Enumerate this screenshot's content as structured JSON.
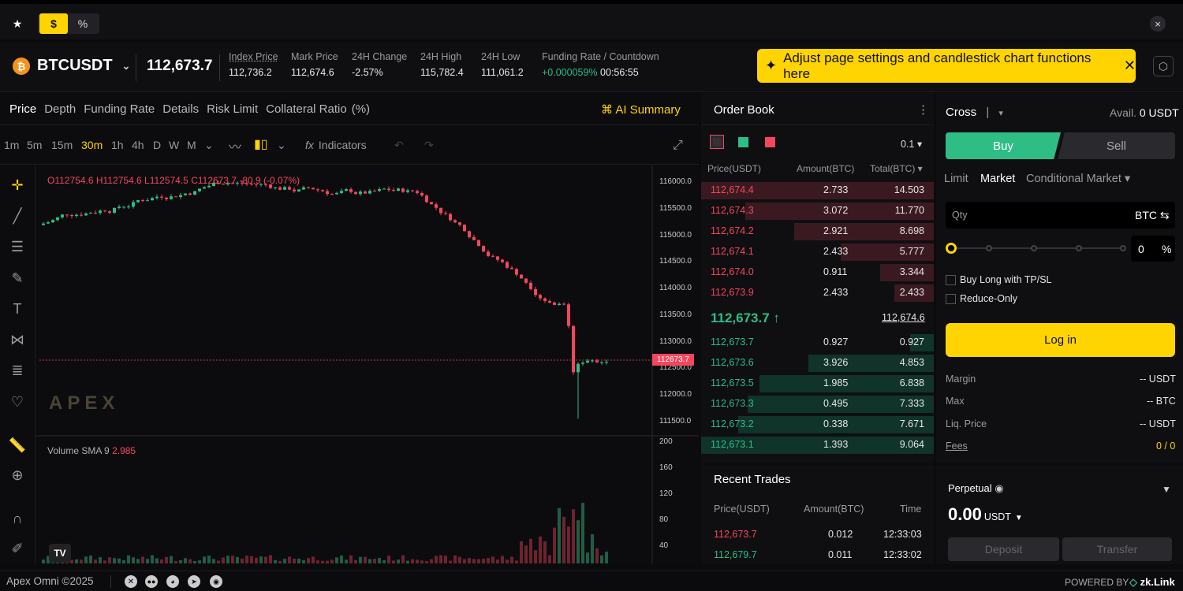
{
  "colors": {
    "accent": "#ffd400",
    "up": "#2ebd85",
    "down": "#f6465d",
    "bg": "#0b0b0d"
  },
  "topbar": {
    "star_icon": "star-icon",
    "dollar": "$",
    "percent": "%",
    "close": "×"
  },
  "ticker": {
    "symbol": "BTCUSDT",
    "price": "112,673.7",
    "stats": [
      {
        "label": "Index Price",
        "value": "112,736.2"
      },
      {
        "label": "Mark Price",
        "value": "112,674.6"
      },
      {
        "label": "24H Change",
        "value": "-2.57%"
      },
      {
        "label": "24H High",
        "value": "115,782.4"
      },
      {
        "label": "24H Low",
        "value": "111,061.2"
      },
      {
        "label": "Funding Rate / Countdown",
        "value": "+0.000059%",
        "countdown": "00:56:55"
      }
    ],
    "banner": "Adjust page settings and candlestick chart functions here"
  },
  "chart": {
    "tabs": [
      "Price",
      "Depth",
      "Funding Rate",
      "Details",
      "Risk Limit",
      "Collateral Ratio",
      "(%)"
    ],
    "ai_summary": "AI Summary",
    "timeframes": [
      "1m",
      "5m",
      "15m",
      "30m",
      "1h",
      "4h",
      "D",
      "W",
      "M"
    ],
    "indicators": "Indicators",
    "ohlc": {
      "o": "O112754.6",
      "h": "H112754.6",
      "l": "L112574.5",
      "c": "C112673.7",
      "chg": "-80.9 (-0.07%)"
    },
    "price_axis": [
      "116000.0",
      "115500.0",
      "115000.0",
      "114500.0",
      "114000.0",
      "113500.0",
      "113000.0",
      "112500.0",
      "112000.0",
      "111500.0"
    ],
    "last_price": "112673.7",
    "volume_label": "Volume SMA 9",
    "volume_value": "2.985",
    "volume_axis": [
      "200",
      "160",
      "120",
      "80",
      "40"
    ],
    "logo": "APEX"
  },
  "orderbook": {
    "title": "Order Book",
    "step": "0.1",
    "headers": [
      "Price(USDT)",
      "Amount(BTC)",
      "Total(BTC)"
    ],
    "asks": [
      [
        "112,674.4",
        "2.733",
        "14.503"
      ],
      [
        "112,674.3",
        "3.072",
        "11.770"
      ],
      [
        "112,674.2",
        "2.921",
        "8.698"
      ],
      [
        "112,674.1",
        "2.433",
        "5.777"
      ],
      [
        "112,674.0",
        "0.911",
        "3.344"
      ],
      [
        "112,673.9",
        "2.433",
        "2.433"
      ]
    ],
    "asks_depth": [
      1.0,
      0.81,
      0.6,
      0.4,
      0.23,
      0.17
    ],
    "mid": "112,673.7",
    "mid_mark": "112,674.6",
    "bids": [
      [
        "112,673.7",
        "0.927",
        "0.927"
      ],
      [
        "112,673.6",
        "3.926",
        "4.853"
      ],
      [
        "112,673.5",
        "1.985",
        "6.838"
      ],
      [
        "112,673.3",
        "0.495",
        "7.333"
      ],
      [
        "112,673.2",
        "0.338",
        "7.671"
      ],
      [
        "112,673.1",
        "1.393",
        "9.064"
      ]
    ],
    "bids_depth": [
      0.1,
      0.54,
      0.75,
      0.8,
      0.84,
      1.0
    ]
  },
  "recent_trades": {
    "title": "Recent Trades",
    "headers": [
      "Price(USDT)",
      "Amount(BTC)",
      "Time"
    ],
    "rows": [
      [
        "112,673.7",
        "0.012",
        "12:33:03",
        "down"
      ],
      [
        "112,679.7",
        "0.011",
        "12:33:02",
        "up"
      ]
    ]
  },
  "trade": {
    "margin_mode": "Cross",
    "avail_label": "Avail.",
    "avail_value": "0 USDT",
    "buy": "Buy",
    "sell": "Sell",
    "order_types": [
      "Limit",
      "Market",
      "Conditional Market"
    ],
    "qty_placeholder": "Qty",
    "qty_unit": "BTC",
    "pct_value": "0",
    "pct_unit": "%",
    "tpsl": "Buy Long with TP/SL",
    "reduce": "Reduce-Only",
    "login": "Log in",
    "info": [
      [
        "Margin",
        "-- USDT"
      ],
      [
        "Max",
        "-- BTC"
      ],
      [
        "Liq. Price",
        "-- USDT"
      ],
      [
        "Fees",
        "0 / 0"
      ]
    ]
  },
  "perpetual": {
    "title": "Perpetual",
    "balance": "0.00",
    "unit": "USDT",
    "deposit": "Deposit",
    "transfer": "Transfer"
  },
  "footer": {
    "copyright": "Apex Omni ©2025",
    "powered": "POWERED BY",
    "brand": "zk.Link"
  }
}
